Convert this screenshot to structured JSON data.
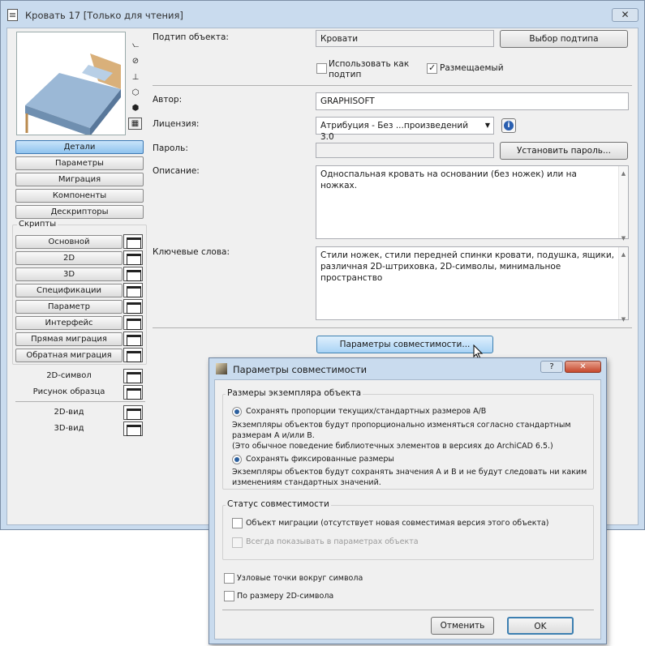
{
  "window": {
    "title": "Кровать 17 [Только для чтения]",
    "close": "✕"
  },
  "view_icons": [
    "⦦",
    "⊘",
    "⊥",
    "⬡",
    "⬢",
    "▦"
  ],
  "nav": {
    "details": "Детали",
    "params": "Параметры",
    "migration": "Миграция",
    "components": "Компоненты",
    "descriptors": "Дескрипторы",
    "scripts_title": "Скрипты",
    "scripts": [
      "Основной",
      "2D",
      "3D",
      "Спецификации",
      "Параметр",
      "Интерфейс",
      "Прямая миграция",
      "Обратная миграция"
    ],
    "symbol2d": "2D-символ",
    "preview_pic": "Рисунок образца",
    "view2d": "2D-вид",
    "view3d": "3D-вид"
  },
  "form": {
    "subtype_label": "Подтип объекта:",
    "subtype_value": "Кровати",
    "subtype_btn": "Выбор подтипа",
    "use_as_subtype": "Использовать как подтип",
    "placeable": "Размещаемый",
    "author_label": "Автор:",
    "author_value": "GRAPHISOFT",
    "license_label": "Лицензия:",
    "license_value": "Атрибуция - Без ...произведений 3.0",
    "password_label": "Пароль:",
    "password_btn": "Установить пароль...",
    "desc_label": "Описание:",
    "desc_value": "Односпальная кровать на основании (без ножек) или на ножках.",
    "keywords_label": "Ключевые слова:",
    "keywords_value": "Стили ножек, стили передней спинки кровати, подушка, ящики, различная 2D-штриховка, 2D-символы, минимальное пространство",
    "compat_btn": "Параметры совместимости..."
  },
  "dialog": {
    "title": "Параметры совместимости",
    "help": "?",
    "close": "✕",
    "group1": "Размеры экземпляра объекта",
    "radio1": "Сохранять пропорции текущих/стандартных размеров A/B",
    "radio1_desc": "Экземпляры объектов будут пропорционально изменяться согласно стандартным размерам A и/или B.",
    "radio1_note": "(Это обычное поведение библиотечных элементов в версиях до ArchiCAD 6.5.)",
    "radio2": "Сохранять фиксированные размеры",
    "radio2_desc": "Экземпляры объектов будут сохранять значения A и B и не будут следовать ни каким изменениям стандартных значений.",
    "group2": "Статус совместимости",
    "chk_migration": "Объект миграции (отсутствует новая совместимая версия этого объекта)",
    "chk_always": "Всегда показывать в параметрах объекта",
    "chk_hotspots": "Узловые точки вокруг символа",
    "chk_fit": "По размеру 2D-символа",
    "cancel": "Отменить",
    "ok": "OK"
  },
  "colors": {
    "accent": "#8fc3ee",
    "frame": "#c9dbee",
    "info": "#2a5fb0"
  }
}
